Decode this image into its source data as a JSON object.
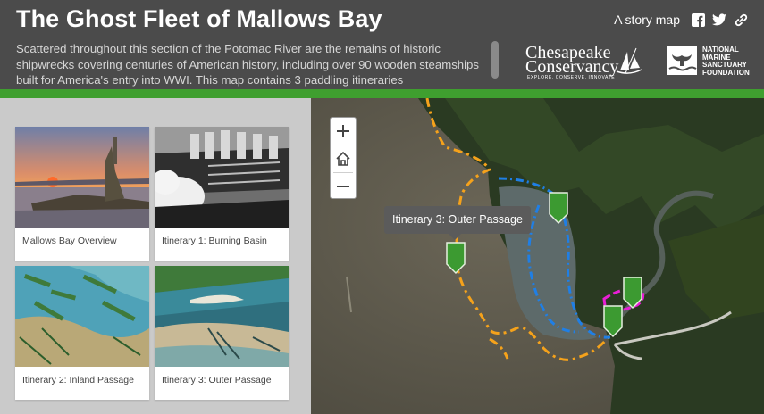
{
  "header": {
    "title": "The Ghost Fleet of Mallows Bay",
    "description": "Scattered throughout this section of the Potomac River are the remains of historic shipwrecks covering centuries of American history, including over 90 wooden steamships built for America's entry into WWI. This map contains 3 paddling itineraries",
    "story_label": "A story map",
    "social_icons": [
      "facebook-icon",
      "twitter-icon",
      "link-icon"
    ],
    "logos": {
      "chesapeake": {
        "line1": "Chesapeake",
        "line2": "Conservancy",
        "tagline": "EXPLORE. CONSERVE. INNOVATE"
      },
      "nms": {
        "line1": "NATIONAL",
        "line2": "MARINE",
        "line3": "SANCTUARY",
        "line4": "FOUNDATION"
      }
    }
  },
  "colors": {
    "header_bg": "#4b4b4b",
    "accent_green": "#3f9f2f",
    "marker_green": "#3c9a31",
    "route_orange": "#f5a21b",
    "route_blue": "#1f7fe6",
    "route_magenta": "#e81fd6",
    "panel_bg": "#cacaca"
  },
  "cards": [
    {
      "caption": "Mallows Bay Overview"
    },
    {
      "caption": "Itinerary 1: Burning Basin"
    },
    {
      "caption": "Itinerary 2: Inland Passage"
    },
    {
      "caption": "Itinerary 3: Outer Passage"
    }
  ],
  "map": {
    "zoom_in": "+",
    "zoom_out": "−",
    "home_icon": "home-icon",
    "tooltip": "Itinerary 3: Outer Passage"
  }
}
